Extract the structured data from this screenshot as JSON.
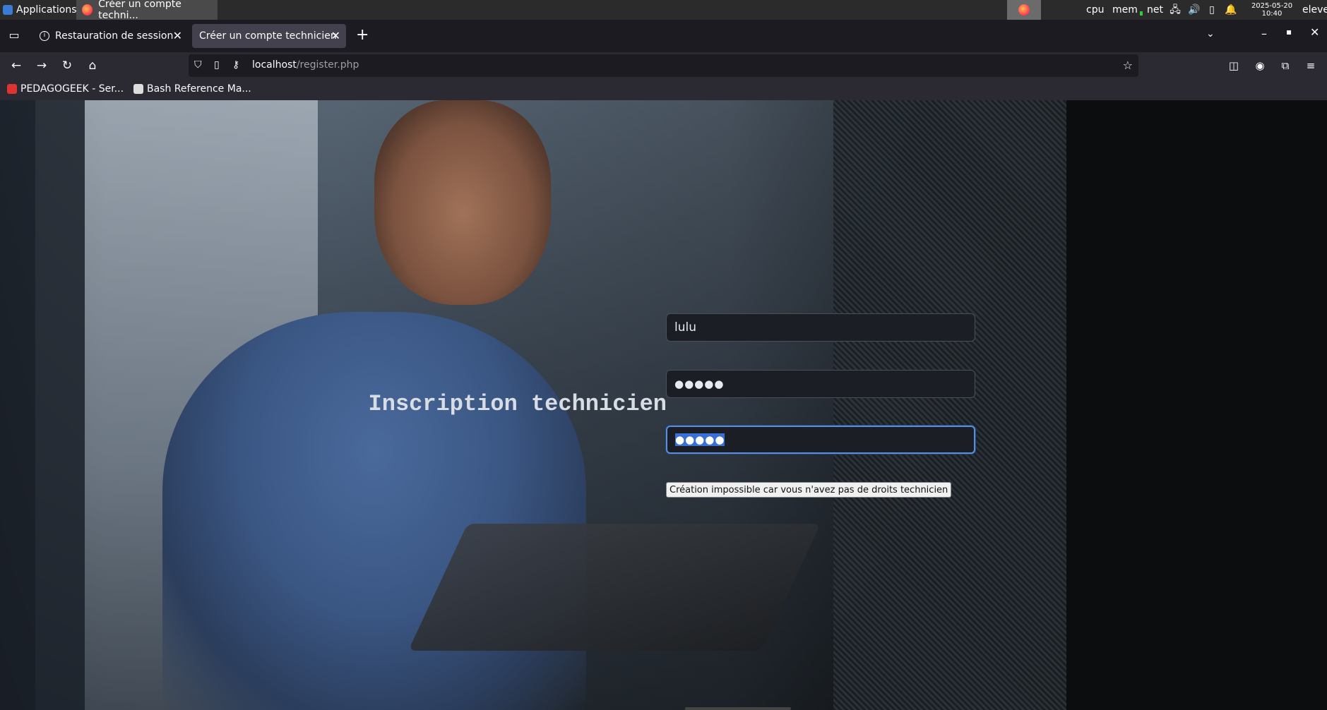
{
  "taskbar": {
    "apps_label": "Applications",
    "window_title": "Créer un compte techni...",
    "cpu": "cpu",
    "mem": "mem",
    "net": "net",
    "date": "2025-05-20",
    "time": "10:40",
    "user": "eleve"
  },
  "tabs": [
    {
      "label": "Restauration de session"
    },
    {
      "label": "Créer un compte technicien"
    }
  ],
  "url": {
    "host": "localhost",
    "path": "/register.php"
  },
  "bookmarks": [
    {
      "label": "PEDAGOGEEK - Ser..."
    },
    {
      "label": "Bash Reference Ma..."
    }
  ],
  "page": {
    "title": "Inscription technicien",
    "username_value": "lulu",
    "password_mask": "●●●●●",
    "confirm_mask": "●●●●●",
    "submit_label": "Création impossible car vous n'avez pas de droits technicien"
  }
}
